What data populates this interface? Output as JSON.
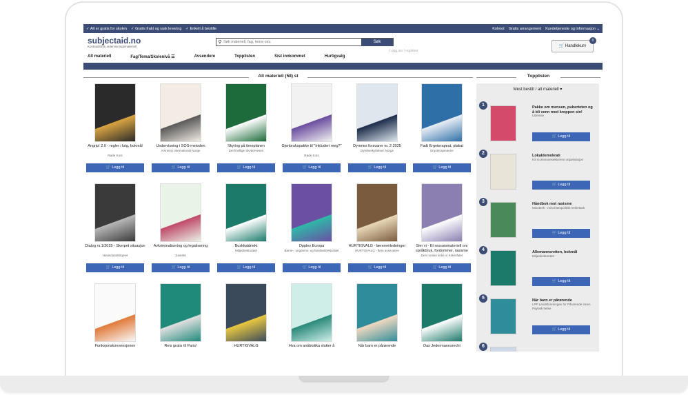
{
  "topbar": {
    "usp": [
      "Alt er gratis for skolen",
      "Gratis frakt og rask levering",
      "Enkelt å bestille"
    ],
    "links": [
      "Kohoot",
      "Gratis arrangement",
      "Kundetjeneste og informasjon ⌄"
    ]
  },
  "logo": {
    "name": "subjectaid.no",
    "tagline": "Kostnadsfritt undervisningsmateriell"
  },
  "search": {
    "placeholder": "Søk materiell, fag, tema osv.",
    "button": "Søk"
  },
  "login": "Logg inn / registrer",
  "cart": {
    "label": "Handlekurv",
    "count": "0"
  },
  "nav": [
    "Alt materiell",
    "Fag/Tema/Skolenivå ☰",
    "Avsendere",
    "Topplisten",
    "Sist innkommet",
    "Hurtigvalg"
  ],
  "main_title": "Alt materiell (58) st",
  "side_title": "Topplisten",
  "add_label": "Legg til",
  "products": [
    {
      "title": "Angrip! 2.0 - regler i krig, bokmål",
      "publisher": "Røde Kors",
      "color": "#2a2a2a",
      "accent": "#d9a441"
    },
    {
      "title": "Undervisning i SOS-metoden",
      "publisher": "Amnesty International Norge",
      "color": "#f3ece5",
      "accent": "#5a5a5a"
    },
    {
      "title": "Skyting på timeplanen",
      "publisher": "Det frivillige Skyttervesen",
      "color": "#1d6b3a",
      "accent": "#ffffff"
    },
    {
      "title": "Gjenbrukspakke til \"Inkludert meg?\"",
      "publisher": "Røde Kors",
      "color": "#f2f2f2",
      "accent": "#6b4ea0"
    },
    {
      "title": "Dyrenes forsvarer nr. 2 2025",
      "publisher": "Dyrebeskyttelsen Norge",
      "color": "#dfe6ee",
      "accent": "#1d2d4a"
    },
    {
      "title": "Fadt Ergoterapeut, plakat",
      "publisher": "Ergoterapeutene",
      "color": "#2e6fa8",
      "accent": "#e8eef5"
    },
    {
      "title": "Dialog nr.1/2025 - Skerpet situasjon",
      "publisher": "Havindustritilsynet",
      "color": "#3a3a3a",
      "accent": "#b7b7b7"
    },
    {
      "title": "Avkriminalisering og legalisering",
      "publisher": "Juvente",
      "color": "#eaf3e7",
      "accent": "#c04a6a"
    },
    {
      "title": "Buskkaldriekt",
      "publisher": "Miljødirektoratet",
      "color": "#1b7a6a",
      "accent": "#ffffff"
    },
    {
      "title": "Opplev Europa",
      "publisher": "Barne-, ungdoms- og familiedirektoratet",
      "color": "#6a4fa3",
      "accent": "#2fb8a8"
    },
    {
      "title": "HURTIGVALG - lærerveiledninger",
      "publisher": "HURTIGVALG - flere avsendere",
      "color": "#7a5b3e",
      "accent": "#e8d8b8"
    },
    {
      "title": "Sier vi - Et ressursmateriell om språkbruk, fordommer, rasisme",
      "publisher": "Den norske kirke v/ Kirkerådet",
      "color": "#8a7fb0",
      "accent": "#ffffff"
    },
    {
      "title": "Funksjonskonvensjonen",
      "publisher": "",
      "color": "#fafafa",
      "accent": "#e07a3a"
    },
    {
      "title": "Reis gratis til Paris!",
      "publisher": "",
      "color": "#1f8a7a",
      "accent": "#e0e0e0"
    },
    {
      "title": "HURTIGVALG",
      "publisher": "",
      "color": "#3a4a5a",
      "accent": "#e8c840"
    },
    {
      "title": "Hva om antibiotika slutter å",
      "publisher": "",
      "color": "#cfeee8",
      "accent": "#2a8a7a"
    },
    {
      "title": "Når barn er pårørende",
      "publisher": "",
      "color": "#2f8d9a",
      "accent": "#f0d8c0"
    },
    {
      "title": "Das Jedermannsrecht",
      "publisher": "",
      "color": "#1b7a6a",
      "accent": "#ffffff"
    }
  ],
  "toplist": {
    "heading": "Mest bestilt / alt materiell ▾",
    "items": [
      {
        "num": "1",
        "title": "Pakke om mensen, puberteten og å bli venn med kroppen sin!",
        "publisher": "Libresse",
        "color": "#d44a6a"
      },
      {
        "num": "2",
        "title": "Lokaldemokrati",
        "publisher": "KS Kommunesektorens organisasjon",
        "color": "#e9e4d8"
      },
      {
        "num": "3",
        "title": "Håndbok mot rasisme",
        "publisher": "Minotenk - minoritetspolitisk tenketank",
        "color": "#4a8a5a"
      },
      {
        "num": "4",
        "title": "Allemannsretten, bokmål",
        "publisher": "Miljødirektoratet",
        "color": "#1b7a6a"
      },
      {
        "num": "5",
        "title": "Når barn er pårørende",
        "publisher": "LPP Landsforeningen for Pårørende innen Psykisk helse",
        "color": "#2f8d9a"
      },
      {
        "num": "6",
        "title": "",
        "publisher": "",
        "color": "#cfd8e6"
      }
    ]
  }
}
